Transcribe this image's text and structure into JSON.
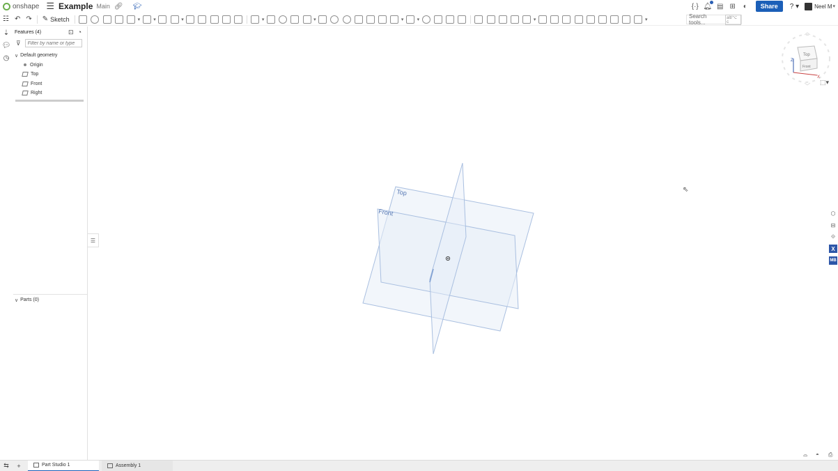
{
  "app": {
    "logo_text": "onshape",
    "doc_title": "Example",
    "doc_branch": "Main",
    "share_label": "Share",
    "help_label": "?",
    "user_name": "Neel M"
  },
  "toolbar": {
    "sketch_label": "Sketch",
    "search_placeholder": "Search tools...",
    "search_shortcut": "alt/⌥ c"
  },
  "features_panel": {
    "title": "Features (4)",
    "filter_placeholder": "Filter by name or type",
    "group_label": "Default geometry",
    "items": [
      {
        "label": "Origin",
        "type": "origin"
      },
      {
        "label": "Top",
        "type": "plane"
      },
      {
        "label": "Front",
        "type": "plane"
      },
      {
        "label": "Right",
        "type": "plane"
      }
    ],
    "parts_label": "Parts (0)"
  },
  "viewport": {
    "planes": [
      "Top",
      "Front"
    ],
    "viewcube_faces": [
      "Top",
      "Front"
    ],
    "axes": [
      "Z",
      "X"
    ]
  },
  "right_panel": {
    "variable_label": "X",
    "units_label": "MB"
  },
  "bottom_tabs": [
    {
      "label": "Part Studio 1",
      "active": true
    },
    {
      "label": "Assembly 1",
      "active": false
    }
  ],
  "colors": {
    "accent": "#1b5fb8",
    "plane_fill": "#e7eef8",
    "plane_stroke": "#a9bfe0",
    "logo_green": "#6cae4d"
  }
}
